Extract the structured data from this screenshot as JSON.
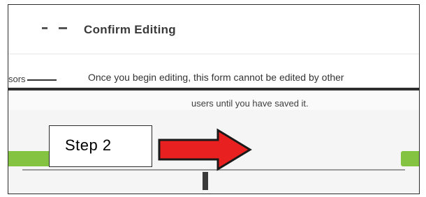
{
  "dialog": {
    "title": "Confirm Editing",
    "message_lead": "sors",
    "message": "Once you begin editing, this form cannot be edited by other",
    "message_line2": "users until you have saved it."
  },
  "annotation": {
    "step_label": "Step 2",
    "arrow_color": "#e8201f"
  },
  "colors": {
    "button_green": "#84c341"
  }
}
